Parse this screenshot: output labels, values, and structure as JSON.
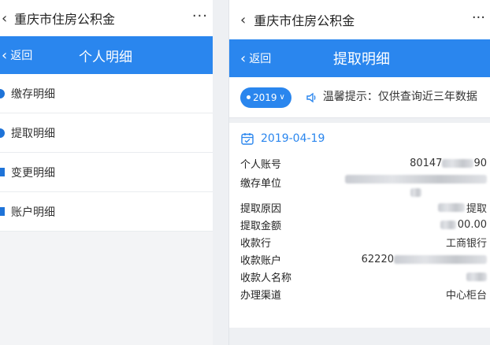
{
  "left": {
    "window_title": "重庆市住房公积金",
    "more": "···",
    "nav_back": "返回",
    "nav_title": "个人明细",
    "menu": [
      {
        "label": "缴存明细"
      },
      {
        "label": "提取明细"
      },
      {
        "label": "变更明细"
      },
      {
        "label": "账户明细"
      }
    ]
  },
  "right": {
    "window_title": "重庆市住房公积金",
    "more": "···",
    "nav_back": "返回",
    "nav_title": "提取明细",
    "year": "2019",
    "notice": "温馨提示：仅供查询近三年数据",
    "date": "2019-04-19",
    "fields": [
      {
        "k": "个人账号",
        "v_pre": "80147",
        "v_post": "90"
      },
      {
        "k": "缴存单位",
        "v_pre": "",
        "v_post": ""
      },
      {
        "k": "提取原因",
        "v_pre": "",
        "v_post": "提取"
      },
      {
        "k": "提取金额",
        "v_pre": "",
        "v_post": "00.00"
      },
      {
        "k": "收款行",
        "v_pre": "",
        "v_post": "工商银行"
      },
      {
        "k": "收款账户",
        "v_pre": "62220",
        "v_post": ""
      },
      {
        "k": "收款人名称",
        "v_pre": "",
        "v_post": ""
      },
      {
        "k": "办理渠道",
        "v_pre": "",
        "v_post": "中心柜台"
      }
    ]
  },
  "colors": {
    "accent": "#2a86ee",
    "menu_dot": "#1e73d8"
  }
}
